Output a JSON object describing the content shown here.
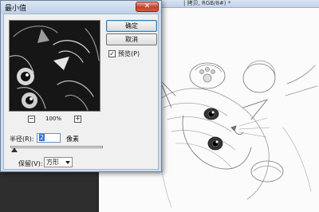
{
  "document": {
    "title": "| 拷贝, RGB/8#) *"
  },
  "dialog": {
    "title": "最小值",
    "close_symbol": "✕",
    "ok_label": "确定",
    "cancel_label": "取消",
    "preview_checked_mark": "✓",
    "preview_label": "预览(P)",
    "zoom_out_symbol": "−",
    "zoom_in_symbol": "+",
    "zoom_level": "100%",
    "radius_label": "半径(R):",
    "radius_value": "2",
    "radius_unit": "像素",
    "preserve_label": "保留(V):",
    "preserve_value": "方形"
  },
  "icons": {
    "close": "close-icon",
    "zoom_out": "minus-icon",
    "zoom_in": "plus-icon",
    "checkbox": "check-icon",
    "dropdown": "chevron-down-icon"
  },
  "colors": {
    "dialog_frame": "#cfdced",
    "dialog_body": "#f0f0f0",
    "close_button": "#c7402a",
    "selection": "#3a6fd0",
    "workspace": "#2e2e2e",
    "canvas": "#fbfbfb"
  }
}
